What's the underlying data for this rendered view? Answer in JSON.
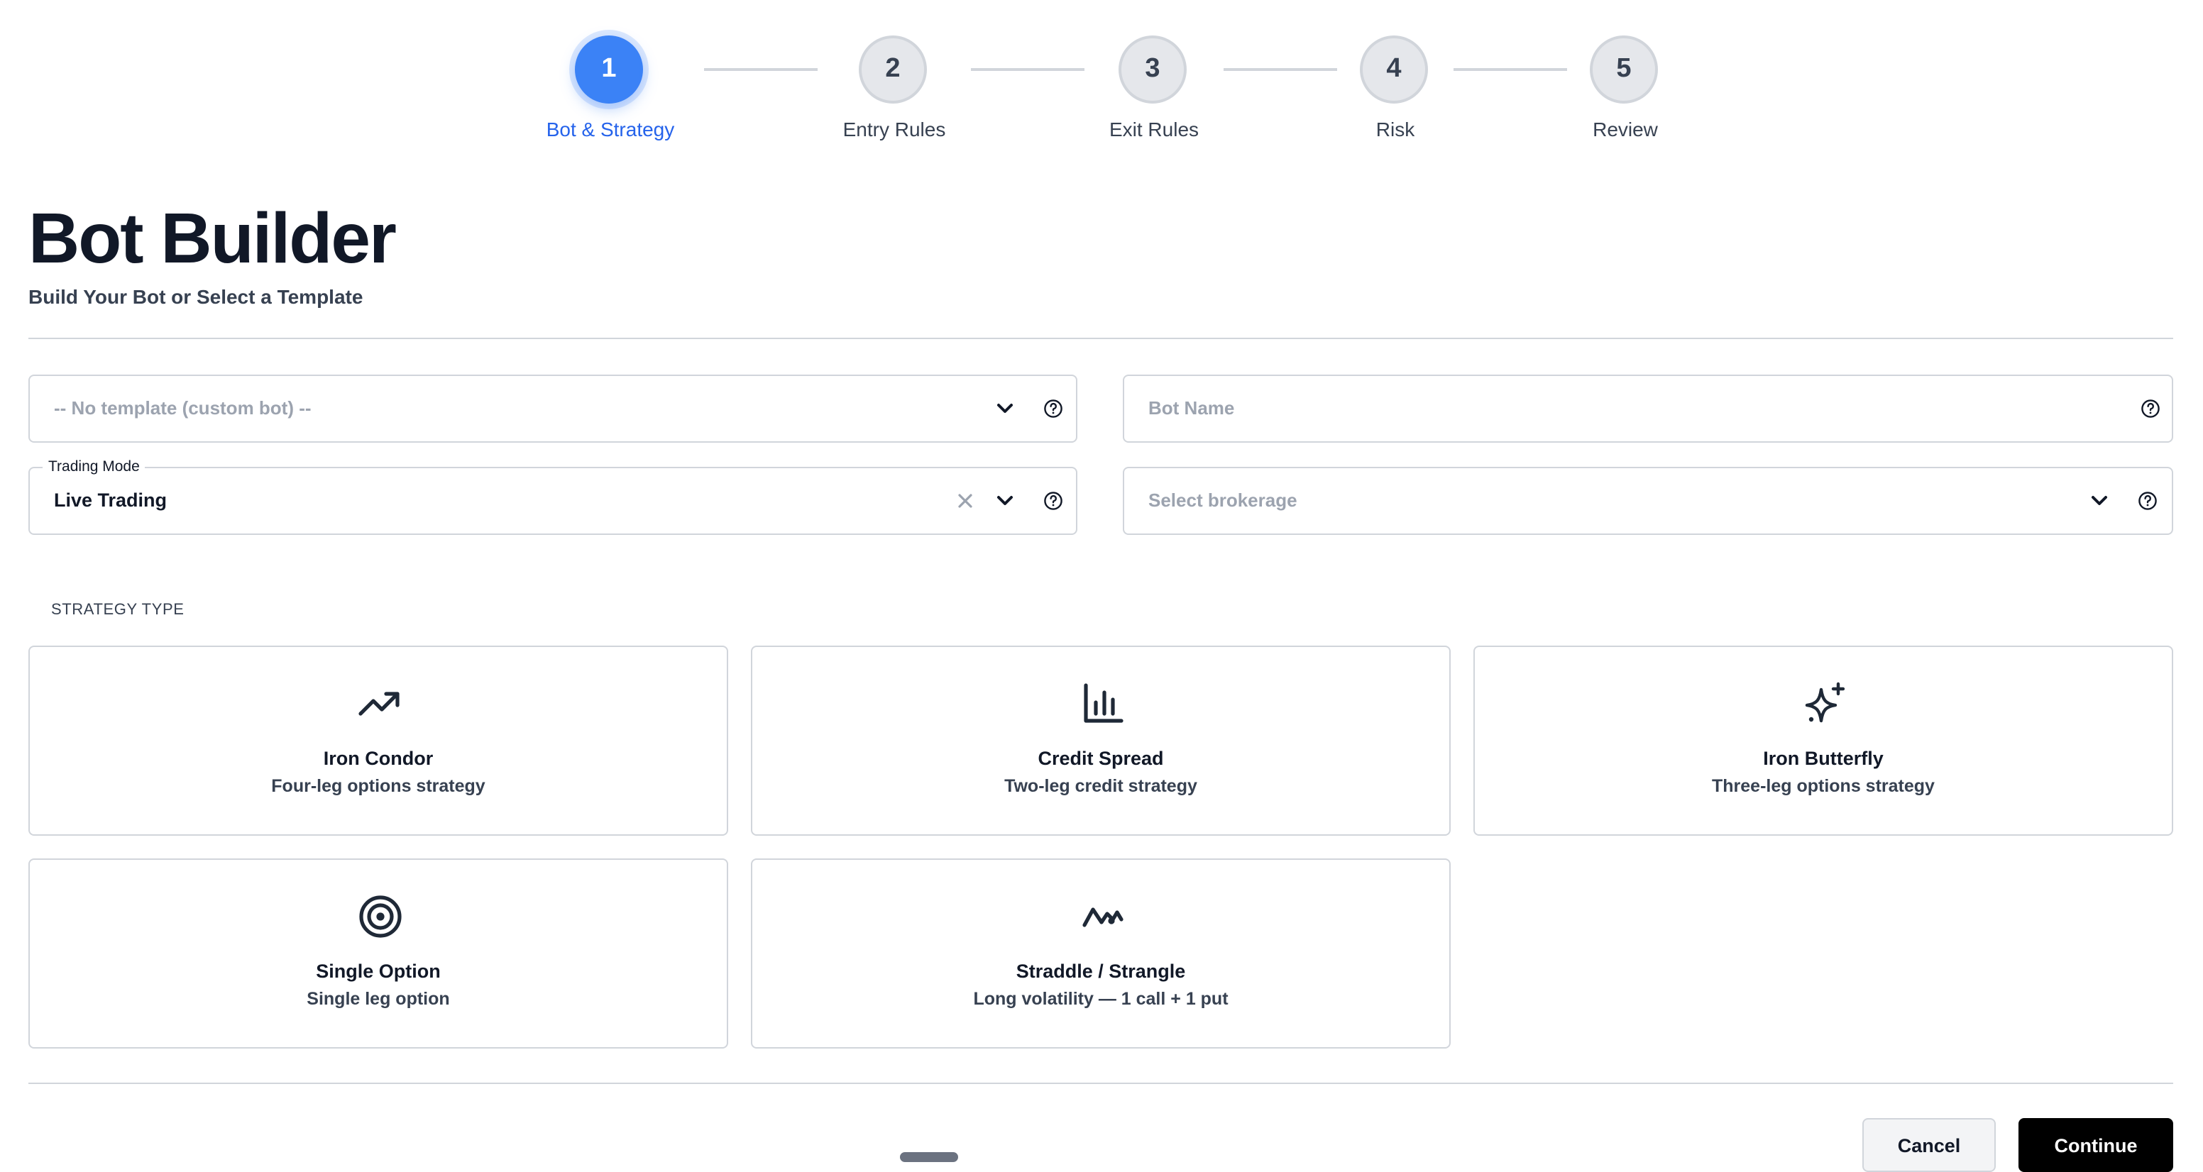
{
  "stepper": {
    "steps": [
      {
        "number": "1",
        "label": "Bot & Strategy",
        "active": true
      },
      {
        "number": "2",
        "label": "Entry Rules",
        "active": false
      },
      {
        "number": "3",
        "label": "Exit Rules",
        "active": false
      },
      {
        "number": "4",
        "label": "Risk",
        "active": false
      },
      {
        "number": "5",
        "label": "Review",
        "active": false
      }
    ]
  },
  "header": {
    "title": "Bot Builder",
    "subtitle": "Build Your Bot or Select a Template"
  },
  "form": {
    "template": {
      "value": "-- No template (custom bot) --",
      "icon": "chevron-down-icon",
      "help_icon": "help-circle-icon"
    },
    "bot_name": {
      "placeholder": "Bot Name",
      "value": "",
      "help_icon": "help-circle-icon"
    },
    "trading_mode": {
      "label": "Trading Mode",
      "value": "Live Trading",
      "clear_icon": "close-icon",
      "icon": "chevron-down-icon",
      "help_icon": "help-circle-icon"
    },
    "brokerage": {
      "placeholder": "Select brokerage",
      "icon": "chevron-down-icon",
      "help_icon": "help-circle-icon"
    }
  },
  "strategy": {
    "section_label": "STRATEGY TYPE",
    "cards": [
      {
        "title": "Iron Condor",
        "description": "Four-leg options strategy",
        "icon": "trending-up-icon"
      },
      {
        "title": "Credit Spread",
        "description": "Two-leg credit strategy",
        "icon": "bar-chart-icon"
      },
      {
        "title": "Iron Butterfly",
        "description": "Three-leg options strategy",
        "icon": "sparkles-icon"
      },
      {
        "title": "Single Option",
        "description": "Single leg option",
        "icon": "target-icon"
      },
      {
        "title": "Straddle / Strangle",
        "description": "Long volatility — 1 call + 1 put",
        "icon": "mountain-icon"
      }
    ]
  },
  "footer": {
    "cancel_label": "Cancel",
    "continue_label": "Continue"
  },
  "colors": {
    "accent": "#3b82f6",
    "active_label": "#2563eb",
    "primary_button": "#000000"
  }
}
